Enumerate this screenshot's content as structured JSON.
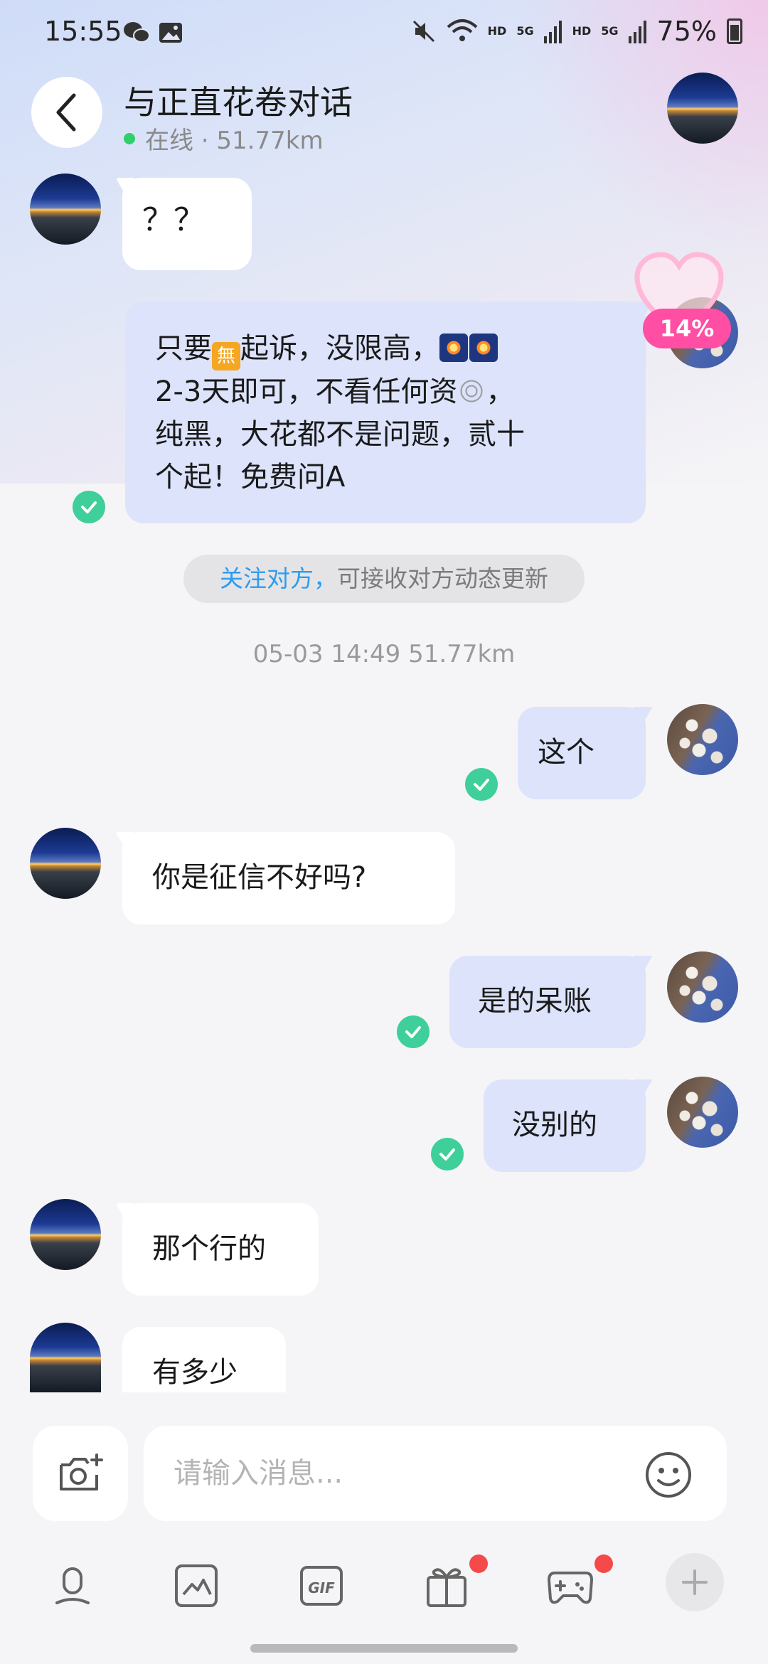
{
  "status_bar": {
    "time": "15:55",
    "hd1": "HD",
    "hd2": "HD",
    "net1": "5G",
    "net2": "5G",
    "battery": "75%"
  },
  "header": {
    "title": "与正直花卷对话",
    "status": "在线 · 51.77km"
  },
  "messages": {
    "m1": "？？",
    "m2_p1": "只要",
    "m2_e1": "無",
    "m2_p2": "起诉，没限高，",
    "m2_p3": "2-3天即可，不看任何资",
    "m2_p4": "，",
    "m2_p5": "纯黑，大花都不是问题，贰十",
    "m2_p6": "个起！免费问A",
    "m3": "这个",
    "m4": "你是征信不好吗?",
    "m5": "是的呆账",
    "m6": "没别的",
    "m7": "那个行的",
    "m8": "有多少"
  },
  "notice": {
    "link": "关注对方，",
    "text": "可接收对方动态更新"
  },
  "timestamp": "05-03 14:49  51.77km",
  "intimacy": {
    "percent": "14%"
  },
  "composer": {
    "placeholder": "请输入消息..."
  },
  "toolbar_icons": [
    "voice-icon",
    "image-icon",
    "gif-icon",
    "gift-icon",
    "game-icon",
    "plus-icon"
  ],
  "colors": {
    "right_bubble": "#dce3fb",
    "left_bubble": "#ffffff",
    "check": "#3fcf9b",
    "accent_link": "#2c9cf0",
    "badge_pink": "#ff4ea3",
    "online": "#2fcf6b"
  }
}
